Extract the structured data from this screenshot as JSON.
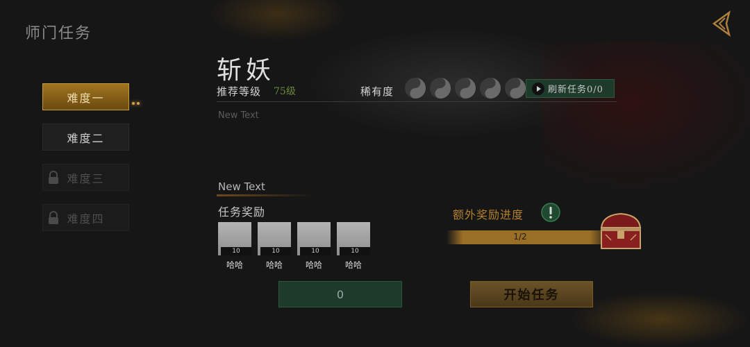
{
  "header": {
    "title": "师门任务",
    "back_icon": "back-arrow-icon"
  },
  "difficulty_tabs": [
    {
      "label": "难度一",
      "state": "active"
    },
    {
      "label": "难度二",
      "state": "normal"
    },
    {
      "label": "难度三",
      "state": "locked"
    },
    {
      "label": "难度四",
      "state": "locked"
    }
  ],
  "mission": {
    "name": "斩妖",
    "recommend_label": "推荐等级",
    "recommend_value": "75级",
    "rarity_label": "稀有度",
    "rarity_count": 5,
    "refresh_label": "刷新任务0/0",
    "description": "New Text"
  },
  "rewards": {
    "section_text": "New Text",
    "title": "任务奖励",
    "items": [
      {
        "count": "10",
        "name": "哈哈"
      },
      {
        "count": "10",
        "name": "哈哈"
      },
      {
        "count": "10",
        "name": "哈哈"
      },
      {
        "count": "10",
        "name": "哈哈"
      }
    ]
  },
  "extra_reward": {
    "label": "额外奖励进度",
    "progress_text": "1/2",
    "progress": 0.5
  },
  "actions": {
    "left_label": "0",
    "start_label": "开始任务"
  },
  "colors": {
    "accent_gold": "#b5802c",
    "accent_green": "#1d3a2a",
    "level_green": "#6b8a3a"
  }
}
